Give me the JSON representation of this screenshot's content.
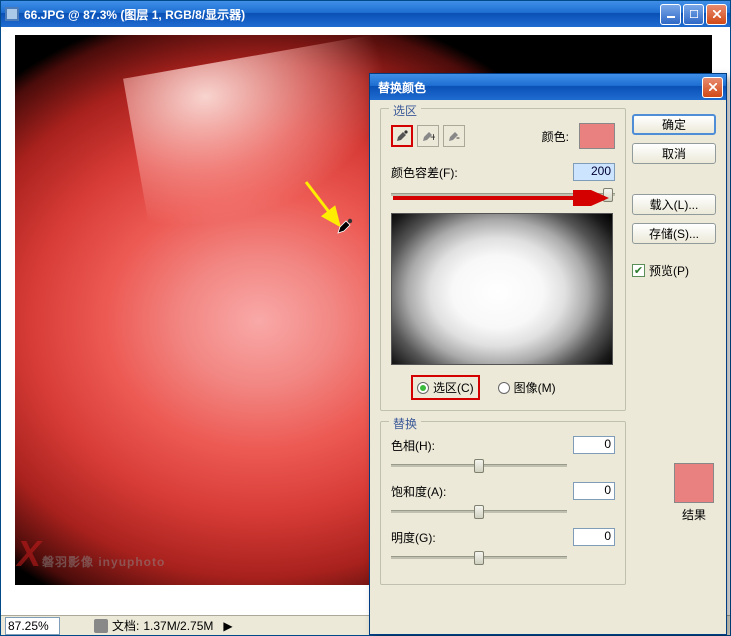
{
  "window": {
    "title": "66.JPG @ 87.3% (图层 1, RGB/8/显示器)"
  },
  "statusbar": {
    "zoom": "87.25%",
    "doc_label": "文档:",
    "doc_value": "1.37M/2.75M"
  },
  "watermark": "磐羽影像 inyuphoto",
  "dialog": {
    "title": "替换颜色",
    "selection_legend": "选区",
    "color_label": "颜色:",
    "fuzziness_label": "颜色容差(F):",
    "fuzziness_value": "200",
    "radio_selection": "选区(C)",
    "radio_image": "图像(M)",
    "replacement_legend": "替换",
    "hue_label": "色相(H):",
    "hue_value": "0",
    "sat_label": "饱和度(A):",
    "sat_value": "0",
    "light_label": "明度(G):",
    "light_value": "0",
    "result_label": "结果",
    "selection_color": "#e8817f",
    "result_color": "#e8817f"
  },
  "buttons": {
    "ok": "确定",
    "cancel": "取消",
    "load": "载入(L)...",
    "save": "存储(S)...",
    "preview": "预览(P)"
  }
}
